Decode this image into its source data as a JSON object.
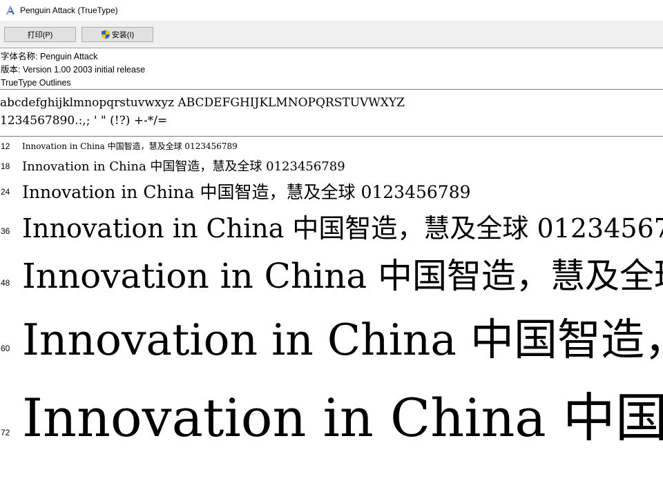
{
  "window": {
    "title": "Penguin Attack (TrueType)"
  },
  "toolbar": {
    "print_label": "打印(P)",
    "install_label": "安装(I)"
  },
  "info": {
    "font_name": "字体名称: Penguin Attack",
    "version": "版本: Version 1.00 2003 initial release",
    "outline_type": "TrueType Outlines"
  },
  "charset": {
    "line1": "abcdefghijklmnopqrstuvwxyz ABCDEFGHIJKLMNOPQRSTUVWXYZ",
    "line2": "1234567890.:,; ' \" (!?) +-*/="
  },
  "samples": {
    "text": "Innovation in China 中国智造，慧及全球 0123456789",
    "rows": [
      {
        "size": "12"
      },
      {
        "size": "18"
      },
      {
        "size": "24"
      },
      {
        "size": "36"
      },
      {
        "size": "48"
      },
      {
        "size": "60"
      },
      {
        "size": "72"
      }
    ]
  },
  "icons": {
    "app": "font-viewer-icon",
    "install": "uac-shield-icon"
  }
}
